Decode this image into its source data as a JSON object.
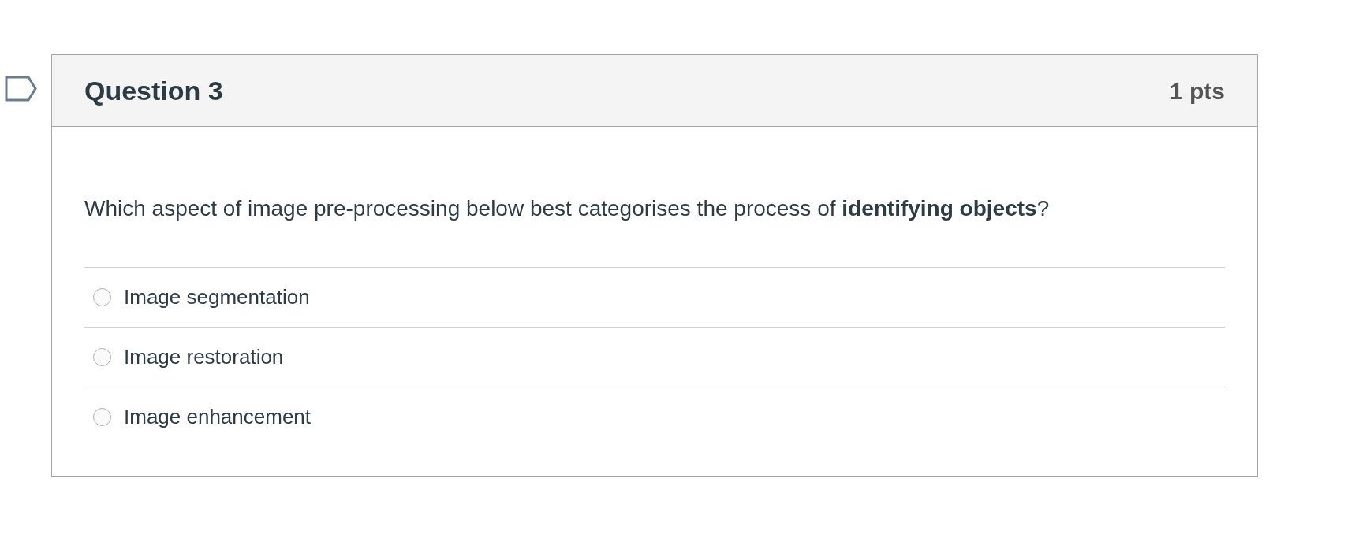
{
  "question": {
    "title": "Question 3",
    "points": "1 pts",
    "text": "Which aspect of image pre-processing below best categorises the process of **identifying objects**?",
    "answers": [
      {
        "label": "Image segmentation",
        "selected": false
      },
      {
        "label": "Image restoration",
        "selected": false
      },
      {
        "label": "Image enhancement",
        "selected": false
      }
    ]
  }
}
